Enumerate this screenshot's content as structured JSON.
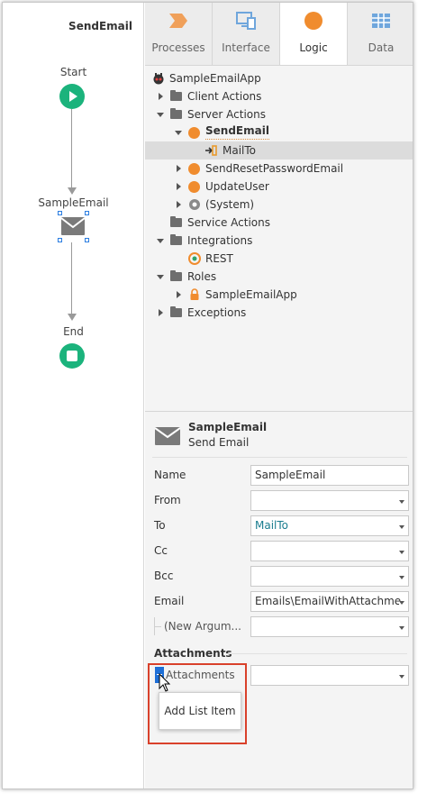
{
  "canvas": {
    "title": "SendEmail",
    "start_label": "Start",
    "node_label": "SampleEmail",
    "end_label": "End"
  },
  "tabs": [
    {
      "label": "Processes",
      "icon": "processes-icon",
      "active": false
    },
    {
      "label": "Interface",
      "icon": "interface-icon",
      "active": false
    },
    {
      "label": "Logic",
      "icon": "logic-icon",
      "active": true
    },
    {
      "label": "Data",
      "icon": "data-icon",
      "active": false
    }
  ],
  "tree": {
    "root": "SampleEmailApp",
    "client_actions": "Client Actions",
    "server_actions": "Server Actions",
    "send_email": "SendEmail",
    "mail_to": "MailTo",
    "send_reset": "SendResetPasswordEmail",
    "update_user": "UpdateUser",
    "system": "(System)",
    "service_actions": "Service Actions",
    "integrations": "Integrations",
    "rest": "REST",
    "roles": "Roles",
    "roles_app": "SampleEmailApp",
    "exceptions": "Exceptions"
  },
  "properties": {
    "title": "SampleEmail",
    "subtitle": "Send Email",
    "rows": [
      {
        "label": "Name",
        "value": "SampleEmail"
      },
      {
        "label": "From",
        "value": ""
      },
      {
        "label": "To",
        "value": "MailTo"
      },
      {
        "label": "Cc",
        "value": ""
      },
      {
        "label": "Bcc",
        "value": ""
      },
      {
        "label": "Email",
        "value": "Emails\\EmailWithAttachme"
      },
      {
        "label": "(New Argum...",
        "value": ""
      }
    ],
    "attachments_section": "Attachments",
    "attachments_label": "Attachments",
    "attachments_value": "",
    "popup_item": "Add List Item"
  },
  "colors": {
    "accent_green": "#1bb37c",
    "accent_orange": "#f08c2e",
    "selection_blue": "#2a7de1",
    "highlight_red": "#d9412b",
    "link_teal": "#1a7d8f"
  }
}
